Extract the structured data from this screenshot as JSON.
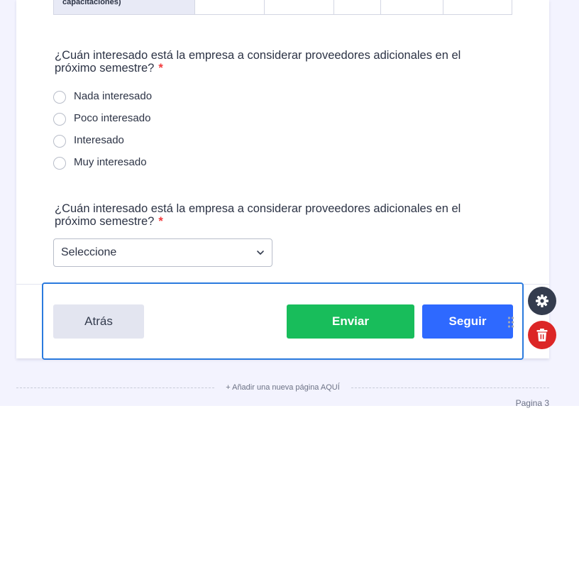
{
  "matrix": {
    "row_label": "capacitaciones)",
    "column_count": 5
  },
  "questions": [
    {
      "title": "¿Cuán interesado está la empresa a considerar proveedores adicionales en el próximo semestre?",
      "required_mark": "*",
      "options": [
        "Nada interesado",
        "Poco interesado",
        "Interesado",
        "Muy interesado"
      ]
    },
    {
      "title": "¿Cuán interesado está la empresa a considerar proveedores adicionales en el próximo semestre?",
      "required_mark": "*",
      "select_value": "Seleccione"
    }
  ],
  "buttons": {
    "back": "Atrás",
    "submit": "Enviar",
    "next": "Seguir"
  },
  "side_tools": {
    "settings_icon": "gear-icon",
    "delete_icon": "trash-icon"
  },
  "add_page_label": "+ Añadir una nueva página AQUÍ",
  "page_label": "Pagina 3",
  "colors": {
    "selection_border": "#2a7ade",
    "submit": "#18bd5b",
    "next": "#2e69ff",
    "delete": "#dc2626",
    "required": "#f23a3c"
  }
}
